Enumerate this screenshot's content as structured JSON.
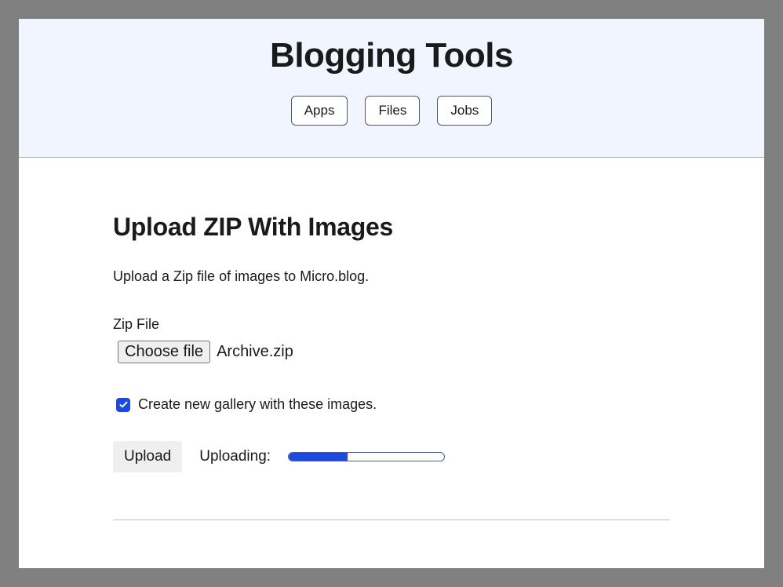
{
  "header": {
    "title": "Blogging Tools",
    "nav": {
      "apps": "Apps",
      "files": "Files",
      "jobs": "Jobs"
    }
  },
  "main": {
    "heading": "Upload ZIP With Images",
    "description": "Upload a Zip file of images to Micro.blog.",
    "file_field": {
      "label": "Zip File",
      "button": "Choose file",
      "filename": "Archive.zip"
    },
    "checkbox": {
      "checked": true,
      "label": "Create new gallery with these images."
    },
    "upload": {
      "button": "Upload",
      "status_label": "Uploading:",
      "progress_percent": 38
    }
  }
}
